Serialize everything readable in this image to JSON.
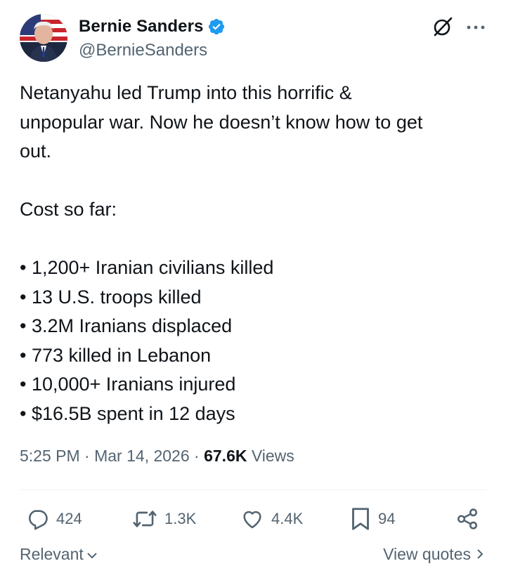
{
  "author": {
    "display_name": "Bernie Sanders",
    "handle": "@BernieSanders",
    "verified": true,
    "verified_color": "#1d9bf0"
  },
  "tweet": {
    "text": "Netanyahu led Trump into this horrific &\nunpopular war. Now he doesn’t know how to get\nout.\n\nCost so far:\n\n• 1,200+ Iranian civilians killed\n• 13 U.S. troops killed\n• 3.2M Iranians displaced\n• 773 killed in Lebanon\n• 10,000+ Iranians injured\n• $16.5B spent in 12 days",
    "time": "5:25 PM",
    "date": "Mar 14, 2026",
    "views_count": "67.6K",
    "views_label": "Views",
    "separator": "·"
  },
  "actions": {
    "replies": "424",
    "reposts": "1.3K",
    "likes": "4.4K",
    "bookmarks": "94"
  },
  "footer": {
    "sort_label": "Relevant",
    "view_quotes_label": "View quotes"
  },
  "icons": {
    "grok": "grok-icon",
    "more": "more-icon",
    "reply": "reply-icon",
    "repost": "repost-icon",
    "like": "like-icon",
    "bookmark": "bookmark-icon",
    "share": "share-icon"
  },
  "colors": {
    "text": "#0f1419",
    "secondary": "#536471",
    "divider": "#eff3f4"
  }
}
